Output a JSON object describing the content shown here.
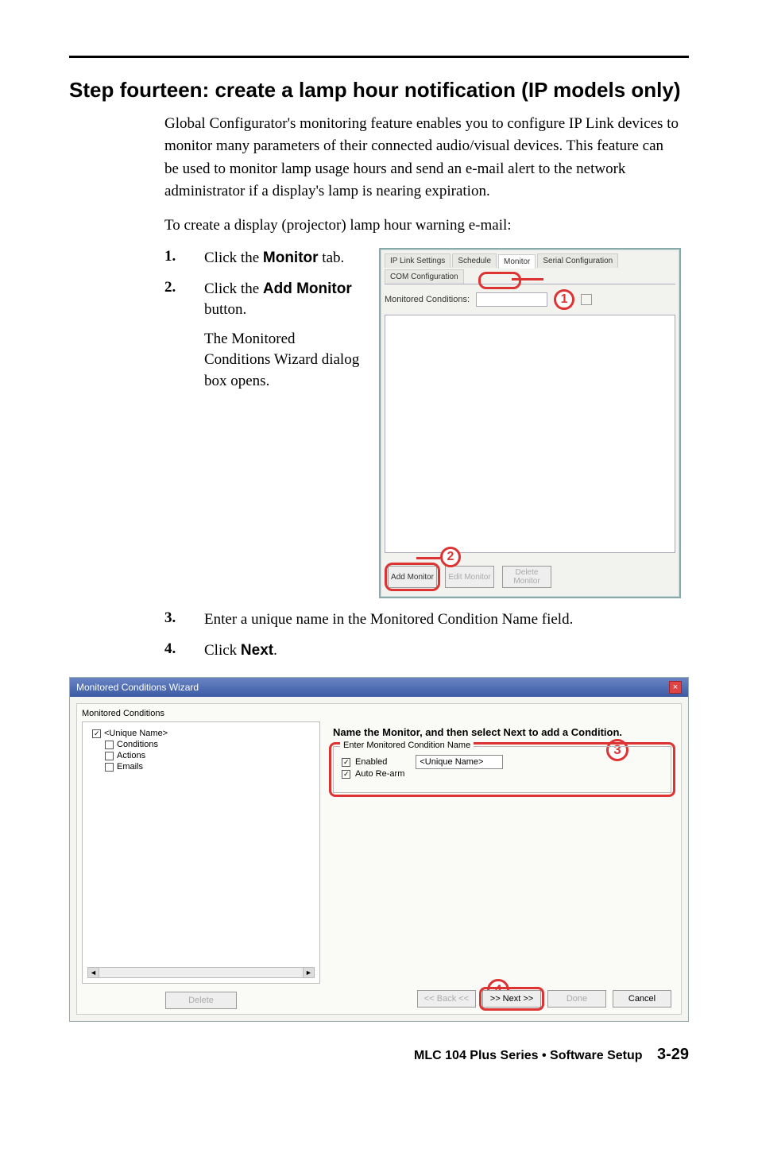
{
  "heading": "Step fourteen: create a lamp hour notification (IP models only)",
  "intro1": "Global Configurator's monitoring feature enables you to configure IP Link devices to monitor many parameters of their connected audio/visual devices.  This feature can be used to monitor lamp usage hours and send an e-mail alert to the network administrator if a display's lamp is nearing expiration.",
  "intro2": "To create a display (projector) lamp hour warning e-mail:",
  "steps": {
    "s1_num": "1.",
    "s1a": "Click the ",
    "s1b": "Monitor",
    "s1c": " tab.",
    "s2_num": "2.",
    "s2a": "Click the ",
    "s2b": "Add Monitor",
    "s2c": " button.",
    "s2_follow": "The Monitored Conditions Wizard dialog box opens.",
    "s3_num": "3.",
    "s3": "Enter a unique name in the Monitored Condition Name field.",
    "s4_num": "4.",
    "s4a": "Click ",
    "s4b": "Next",
    "s4c": "."
  },
  "win1": {
    "tabs": [
      "IP Link Settings",
      "Schedule",
      "Monitor",
      "Serial Configuration",
      "COM Configuration"
    ],
    "mon_label": "Monitored Conditions:",
    "btn_add": "Add Monitor",
    "btn_edit": "Edit Monitor",
    "btn_del": "Delete Monitor",
    "call1": "1",
    "call2": "2"
  },
  "wizard": {
    "title": "Monitored Conditions Wizard",
    "section": "Monitored Conditions",
    "tree": {
      "root": "<Unique Name>",
      "children": [
        "Conditions",
        "Actions",
        "Emails"
      ]
    },
    "right_heading": "Name the Monitor, and then select Next to add a Condition.",
    "fieldset_legend": "Enter Monitored Condition Name",
    "enabled": "Enabled",
    "autorearm": "Auto Re-arm",
    "input_value": "<Unique Name>",
    "delete": "Delete",
    "back": "<< Back <<",
    "next": ">> Next >>",
    "done": "Done",
    "cancel": "Cancel",
    "call3": "3",
    "call4": "4"
  },
  "footer": {
    "text": "MLC 104 Plus Series • Software Setup",
    "page": "3-29"
  }
}
